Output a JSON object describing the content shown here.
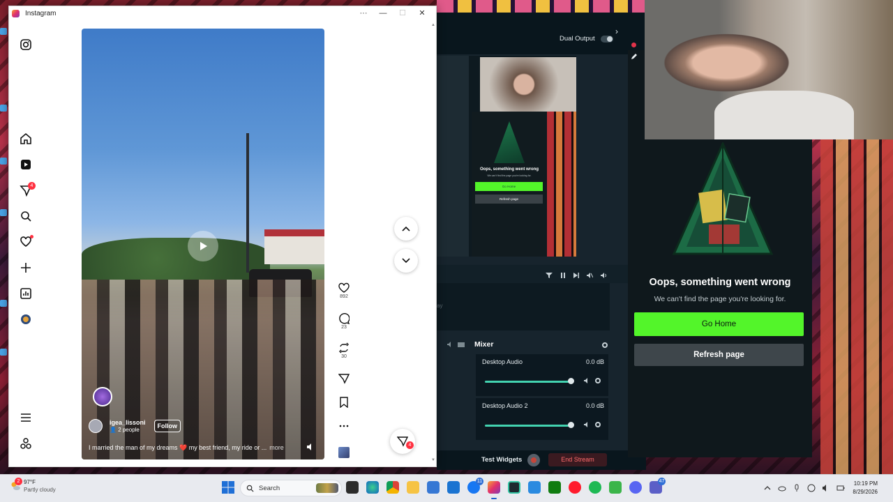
{
  "instagram_window": {
    "title": "Instagram",
    "controls": [
      "···",
      "—",
      "☐",
      "✕"
    ],
    "sidebar": {
      "items": [
        {
          "icon": "instagram-logo-icon"
        },
        {
          "icon": "home-icon"
        },
        {
          "icon": "reels-icon"
        },
        {
          "icon": "messages-icon",
          "badge": "4"
        },
        {
          "icon": "search-icon"
        },
        {
          "icon": "notifications-heart-icon"
        },
        {
          "icon": "create-plus-icon"
        },
        {
          "icon": "dashboard-icon"
        },
        {
          "icon": "profile-avatar-icon"
        },
        {
          "icon": "menu-icon"
        },
        {
          "icon": "also-from-meta-icon"
        }
      ]
    },
    "reel": {
      "author": "igea_lissoni",
      "people": "2 people",
      "follow_label": "Follow",
      "caption": "I married the man of my dreams ❤️ my best friend, my ride or ...",
      "more_label": "more"
    },
    "actions": {
      "likes": "892",
      "comments": "23",
      "reposts": "30"
    },
    "messages_badge": "4"
  },
  "stream_app": {
    "dual_output_label": "Dual Output",
    "scenes_ghost": "ay",
    "mixer": {
      "title": "Mixer",
      "channels": [
        {
          "name": "Desktop Audio",
          "db": "0.0 dB",
          "level": 1.0
        },
        {
          "name": "Desktop Audio 2",
          "db": "0.0 dB",
          "level": 1.0
        }
      ]
    },
    "footer": {
      "test_widgets_label": "Test Widgets",
      "end_stream_label": "End Stream"
    },
    "preview": {
      "title": "Oops, something went wrong",
      "sub": "We can't find the page you're looking for.",
      "go_home": "Go Home",
      "refresh": "Refresh page"
    }
  },
  "error_page": {
    "title": "Oops, something went wrong",
    "subtitle": "We can't find the page you're looking for.",
    "go_home_label": "Go Home",
    "refresh_label": "Refresh page",
    "accent_color": "#53f52a"
  },
  "taskbar": {
    "weather": {
      "temp": "97°F",
      "condition": "Partly cloudy",
      "badge": "2"
    },
    "search_label": "Search",
    "apps": [
      {
        "icon": "file-explorer-icon"
      },
      {
        "icon": "edge-icon"
      },
      {
        "icon": "chrome-icon"
      },
      {
        "icon": "folder-icon"
      },
      {
        "icon": "store-icon"
      },
      {
        "icon": "outlook-icon"
      },
      {
        "icon": "facebook-icon",
        "badge": "11"
      },
      {
        "icon": "instagram-icon"
      },
      {
        "icon": "streamlabs-icon"
      },
      {
        "icon": "onedrive-icon"
      },
      {
        "icon": "xbox-icon"
      },
      {
        "icon": "opera-icon"
      },
      {
        "icon": "spotify-icon"
      },
      {
        "icon": "game-icon"
      },
      {
        "icon": "discord-icon"
      },
      {
        "icon": "teams-icon",
        "badge": "47"
      }
    ],
    "clock": {
      "time": "10:19 PM",
      "date": "8/29/2026"
    }
  }
}
